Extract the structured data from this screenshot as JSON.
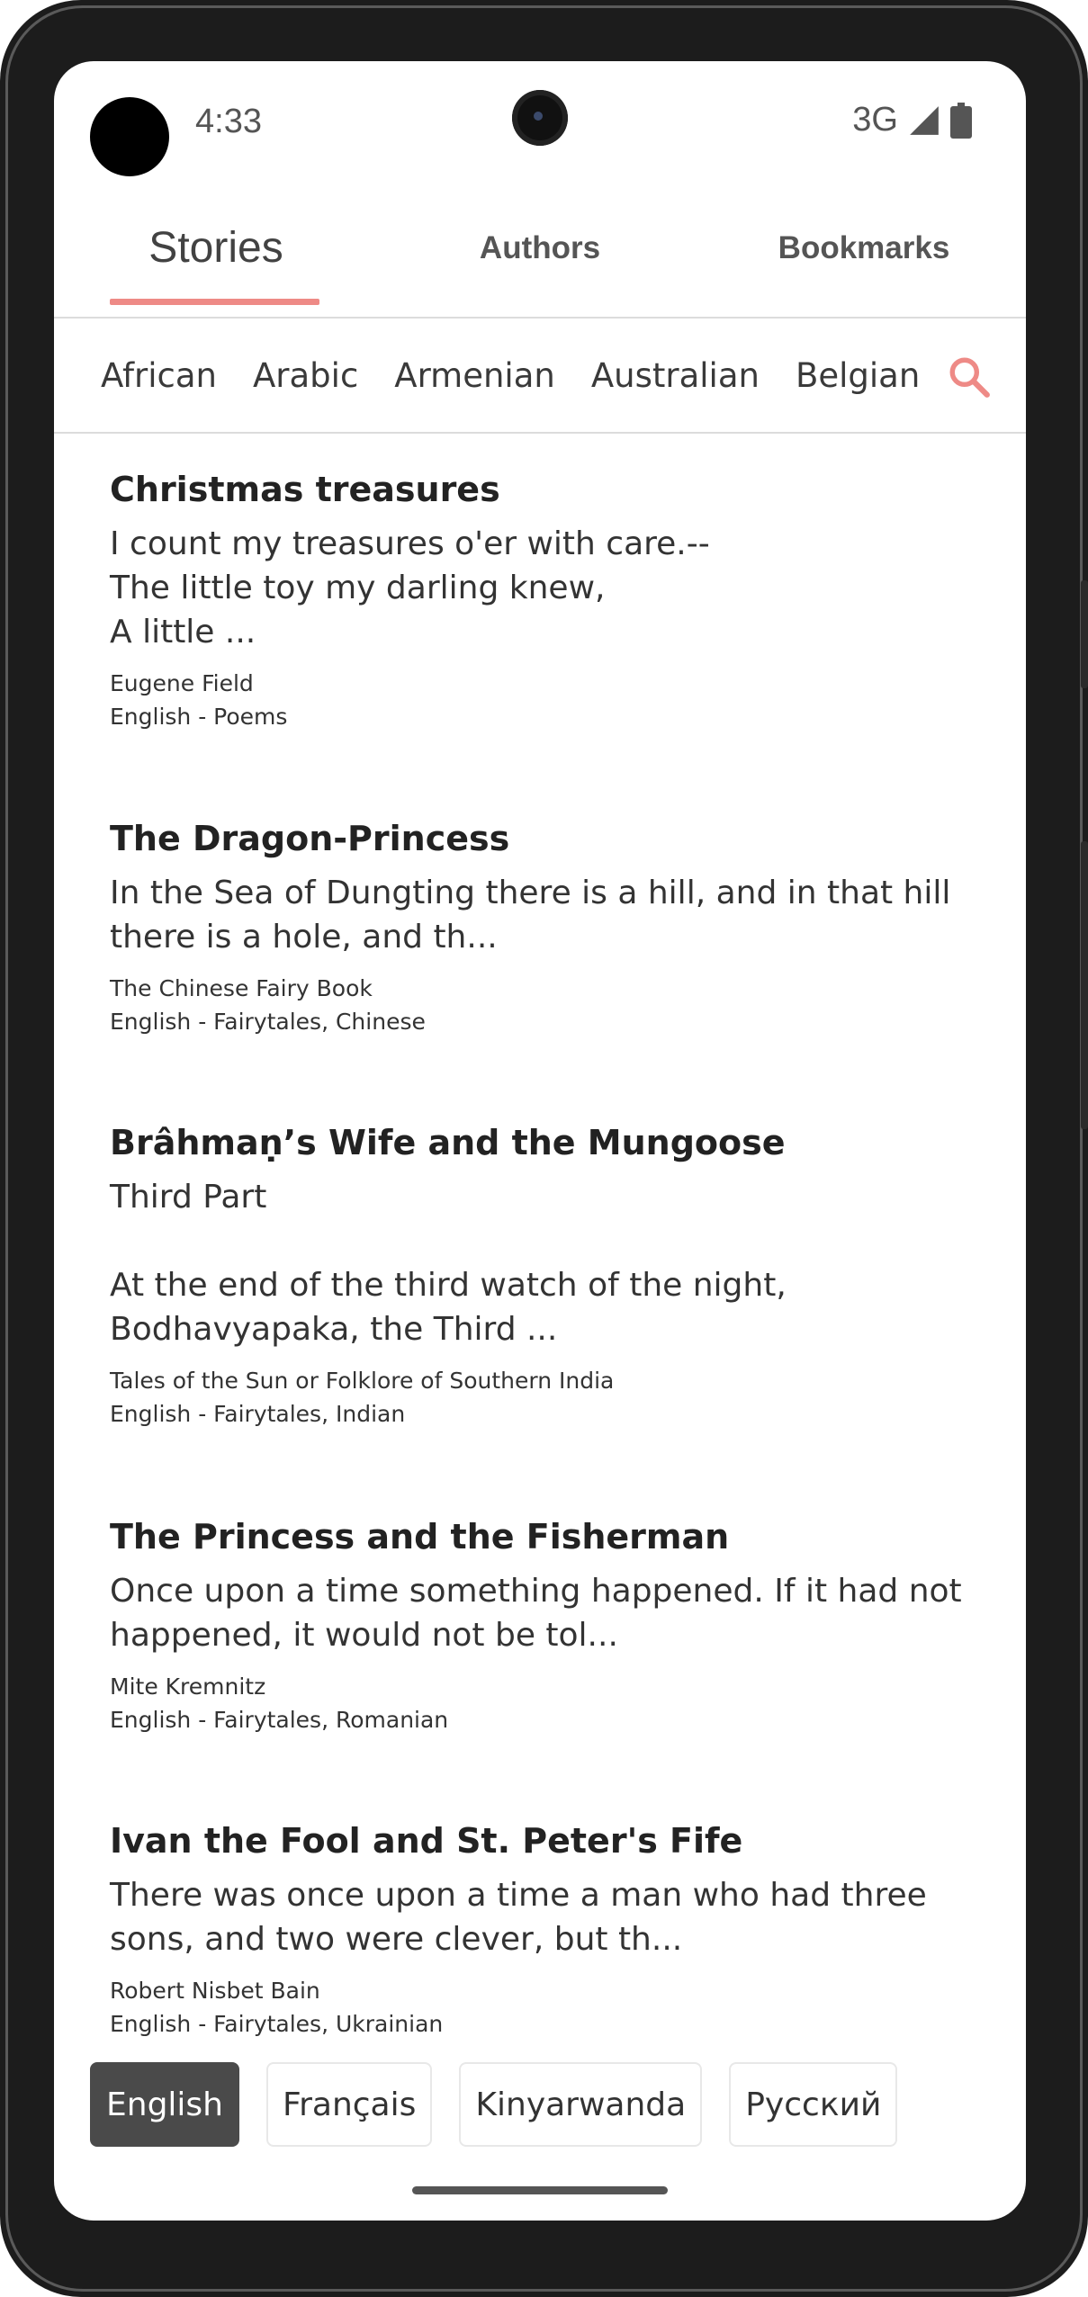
{
  "status": {
    "time": "4:33",
    "network": "3G",
    "icons": [
      "signal-icon",
      "battery-icon"
    ]
  },
  "tabs": [
    {
      "label": "Stories",
      "active": true
    },
    {
      "label": "Authors",
      "active": false
    },
    {
      "label": "Bookmarks",
      "active": false
    }
  ],
  "genres": [
    "African",
    "Arabic",
    "Armenian",
    "Australian",
    "Belgian"
  ],
  "search_icon": "search-icon",
  "stories": [
    {
      "title": "Christmas treasures",
      "excerpt": "I count my treasures o'er with care.--\nThe little toy my darling knew,\nA little ...",
      "author": "Eugene Field",
      "category": "English - Poems"
    },
    {
      "title": "The Dragon-Princess",
      "excerpt": "In the Sea of Dungting there is a hill, and in that hill there is a hole, and th...",
      "author": "The Chinese Fairy Book",
      "category": "English - Fairytales, Chinese"
    },
    {
      "title": "Brâhmaṇ’s Wife and the Mungoose",
      "excerpt": "Third Part\n\nAt the end of the third watch of the night, Bodhavyapaka, the Third ...",
      "author": "Tales of the Sun or Folklore of Southern India",
      "category": "English - Fairytales, Indian"
    },
    {
      "title": "The Princess and the Fisherman",
      "excerpt": "Once upon a time something happened. If it had not happened, it would not be tol...",
      "author": "Mite Kremnitz",
      "category": "English - Fairytales, Romanian"
    },
    {
      "title": "Ivan the Fool and St. Peter's Fife",
      "excerpt": "There was once upon a time a man who had three sons, and two were clever, but th...",
      "author": "Robert Nisbet Bain",
      "category": "English - Fairytales, Ukrainian"
    }
  ],
  "languages": [
    {
      "label": "English",
      "active": true
    },
    {
      "label": "Français",
      "active": false
    },
    {
      "label": "Kinyarwanda",
      "active": false
    },
    {
      "label": "Русский",
      "active": false
    }
  ],
  "colors": {
    "accent": "#ee8a86",
    "active_language_bg": "#4a4a4a"
  }
}
